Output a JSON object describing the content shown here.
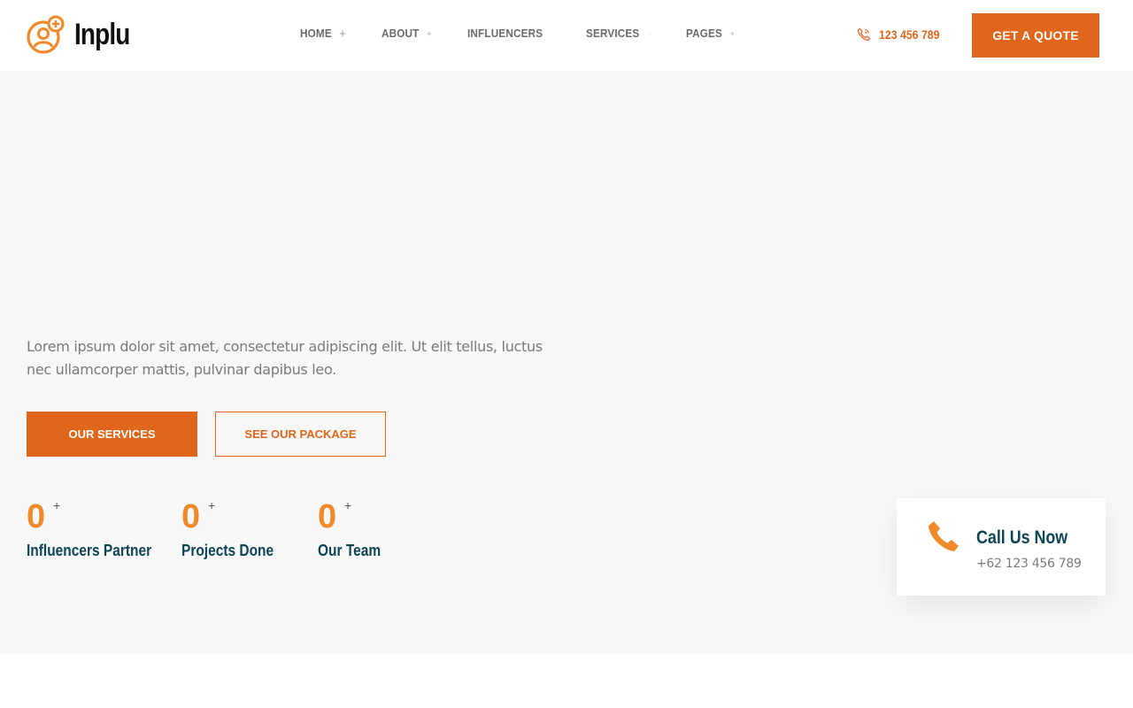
{
  "brand": {
    "name": "Inplu",
    "accent": "#e0661b",
    "accent_light": "#f0892a",
    "heading_color": "#0d4556"
  },
  "nav": {
    "items": [
      {
        "label": "HOME"
      },
      {
        "label": "ABOUT"
      },
      {
        "label": "INFLUENCERS"
      },
      {
        "label": "SERVICES"
      },
      {
        "label": "PAGES"
      }
    ],
    "expand_icon": "plus-icon"
  },
  "header": {
    "phone_icon": "phone-icon",
    "phone": "123 456 789",
    "cta_label": "GET A QUOTE"
  },
  "hero": {
    "description": "Lorem ipsum dolor sit amet, consectetur adipiscing elit. Ut elit tellus, luctus nec ullamcorper mattis, pulvinar dapibus leo.",
    "primary_button": "OUR SERVICES",
    "secondary_button": "SEE OUR PACKAGE"
  },
  "stats": [
    {
      "value": "0",
      "suffix": "+",
      "label": "Influencers Partner"
    },
    {
      "value": "0",
      "suffix": "+",
      "label": "Projects Done"
    },
    {
      "value": "0",
      "suffix": "+",
      "label": "Our Team"
    }
  ],
  "call_card": {
    "icon": "phone-icon",
    "title": "Call Us Now",
    "number": "+62 123 456 789"
  }
}
